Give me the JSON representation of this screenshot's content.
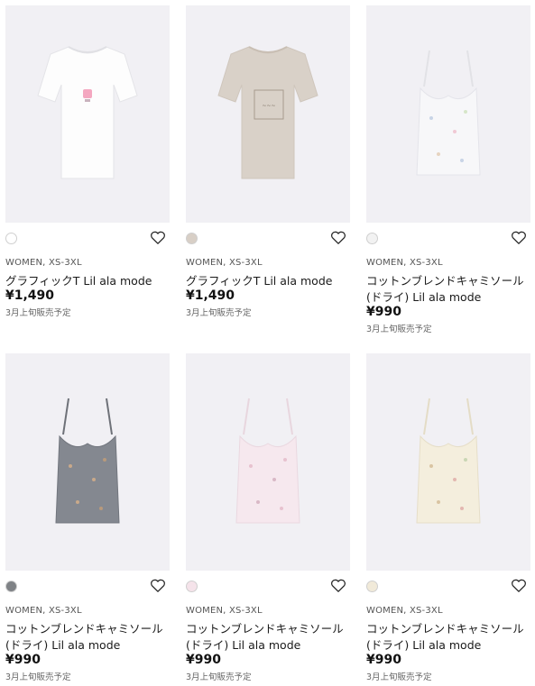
{
  "products": [
    {
      "meta": "WOMEN, XS-3XL",
      "name": "グラフィックT Lil ala mode",
      "price": "¥1,490",
      "note": "3月上旬販売予定",
      "swatch": "#ffffff",
      "garment": "tee",
      "color": "#fdfdfd"
    },
    {
      "meta": "WOMEN, XS-3XL",
      "name": "グラフィックT Lil ala mode",
      "price": "¥1,490",
      "note": "3月上旬販売予定",
      "swatch": "#d8cfc6",
      "garment": "tee",
      "color": "#d9d1c8"
    },
    {
      "meta": "WOMEN, XS-3XL",
      "name": "コットンブレンドキャミソール(ドライ) Lil ala mode",
      "price": "¥990",
      "note": "3月上旬販売予定",
      "swatch": "#f2f2f2",
      "garment": "cami",
      "color": "#f7f7f9"
    },
    {
      "meta": "WOMEN, XS-3XL",
      "name": "コットンブレンドキャミソール(ドライ) Lil ala mode",
      "price": "¥990",
      "note": "3月上旬販売予定",
      "swatch": "#7f8286",
      "garment": "cami",
      "color": "#848890"
    },
    {
      "meta": "WOMEN, XS-3XL",
      "name": "コットンブレンドキャミソール(ドライ) Lil ala mode",
      "price": "¥990",
      "note": "3月上旬販売予定",
      "swatch": "#f5e3ea",
      "garment": "cami",
      "color": "#f6e8ee"
    },
    {
      "meta": "WOMEN, XS-3XL",
      "name": "コットンブレンドキャミソール(ドライ) Lil ala mode",
      "price": "¥990",
      "note": "3月上旬販売予定",
      "swatch": "#f1ead9",
      "garment": "cami",
      "color": "#f4eedd"
    }
  ],
  "icons": {
    "favorite": "heart-icon"
  }
}
